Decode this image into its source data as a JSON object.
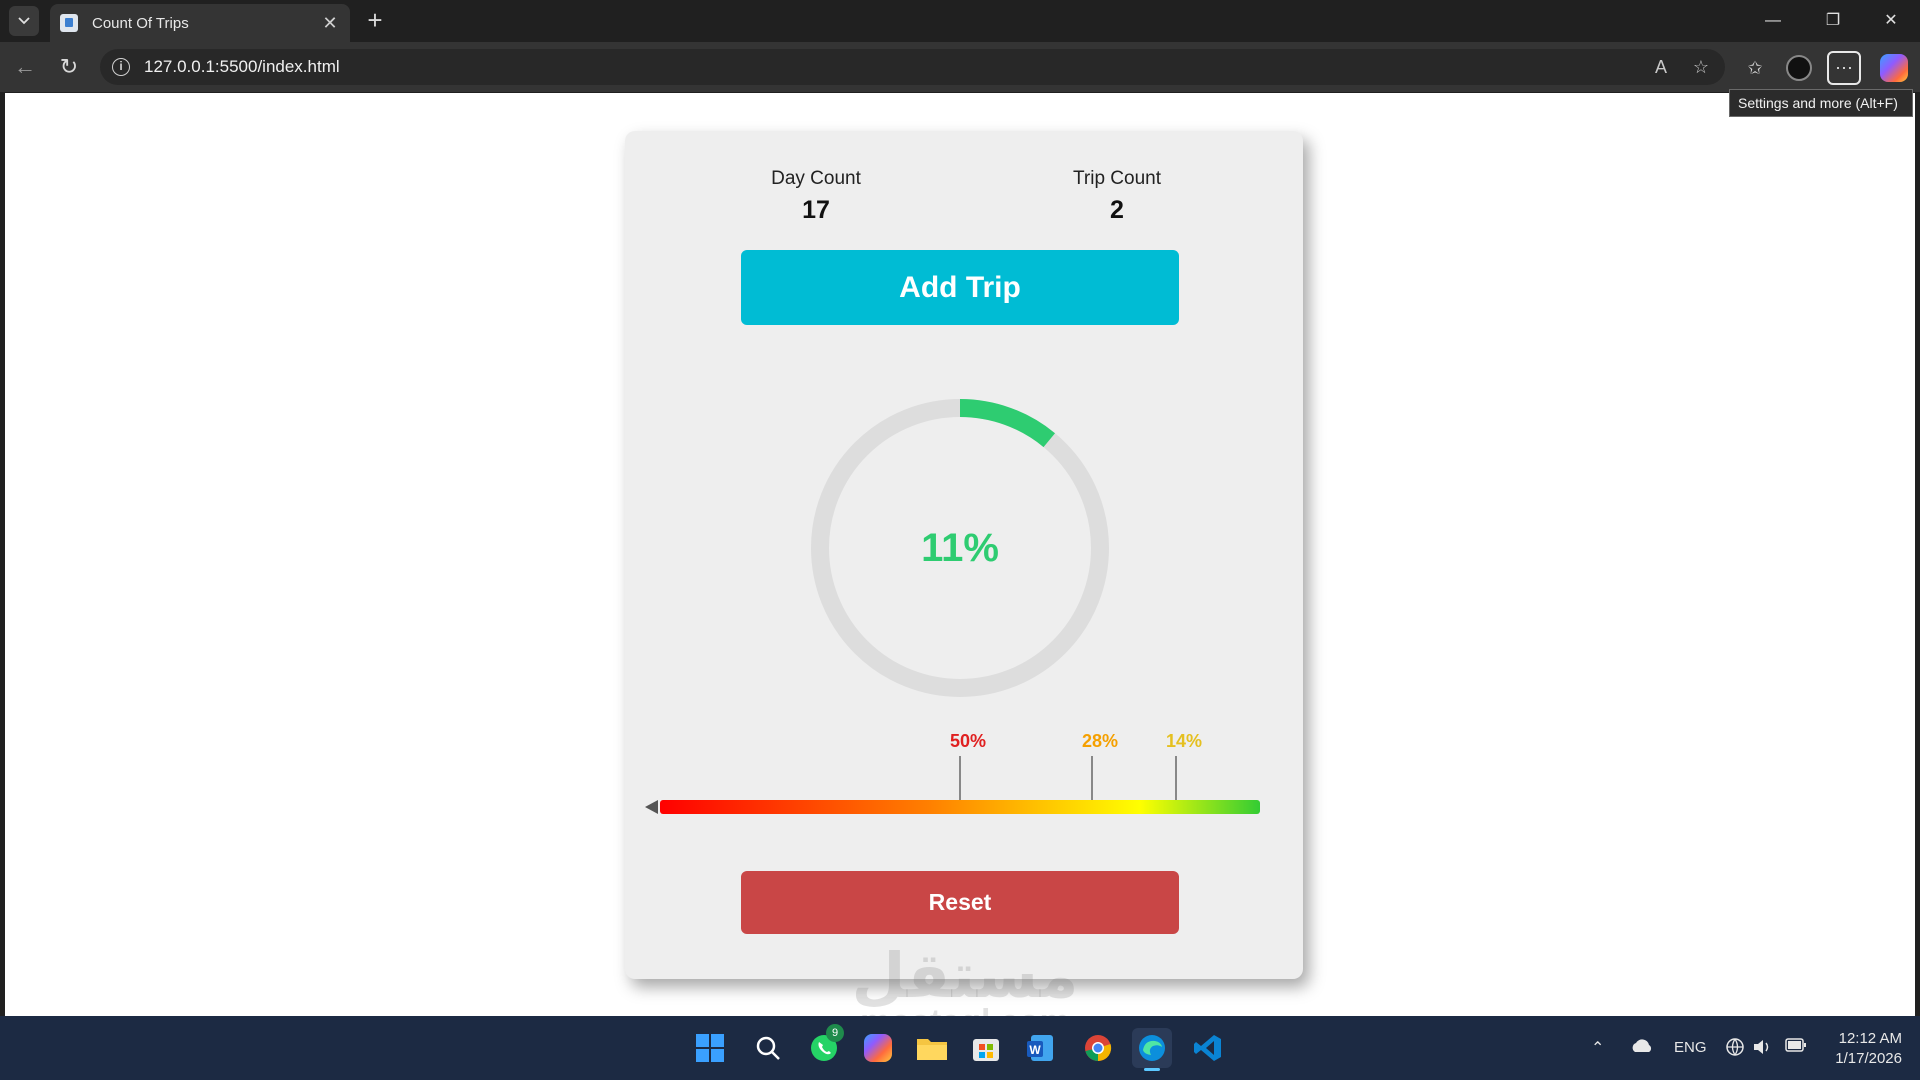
{
  "browser": {
    "tab_title": "Count Of Trips",
    "url": "127.0.0.1:5500/index.html",
    "tooltip": "Settings and more (Alt+F)",
    "icons": [
      "tab-actions-icon",
      "close-icon",
      "plus-icon",
      "minimize-icon",
      "restore-icon",
      "back-icon",
      "refresh-icon",
      "info-icon",
      "read-aloud-icon",
      "star-icon",
      "favorites-icon",
      "profile-icon",
      "more-icon",
      "copilot-icon"
    ]
  },
  "app": {
    "day_count_label": "Day Count",
    "day_count_value": "17",
    "trip_count_label": "Trip Count",
    "trip_count_value": "2",
    "add_trip_label": "Add Trip",
    "reset_label": "Reset",
    "progress_text": "11%",
    "progress_fraction": 0.11,
    "colors": {
      "add_button": "#00bcd4",
      "reset_button": "#c94646",
      "progress": "#2ecc71",
      "ring_track": "#dddddd"
    },
    "gauge": {
      "pointer_fraction": 0.0,
      "markers": [
        {
          "label": "50%",
          "fraction": 0.5,
          "color": "#e02020"
        },
        {
          "label": "28%",
          "fraction": 0.72,
          "color": "#f5a000"
        },
        {
          "label": "14%",
          "fraction": 0.86,
          "color": "#e5c020"
        }
      ],
      "gradient": [
        "#ff0000",
        "#ff8000",
        "#ffff00",
        "#33cc33"
      ]
    }
  },
  "watermark": {
    "arabic": "مستقل",
    "latin": "mostaql.com"
  },
  "taskbar": {
    "apps": [
      "windows-start-icon",
      "search-icon",
      "whatsapp-icon",
      "copilot-icon",
      "file-explorer-icon",
      "store-icon",
      "word-icon",
      "chrome-icon",
      "edge-icon",
      "vscode-icon"
    ],
    "whatsapp_badge": "9",
    "language": "ENG",
    "time": "12:12 AM",
    "date": "1/17/2026"
  }
}
